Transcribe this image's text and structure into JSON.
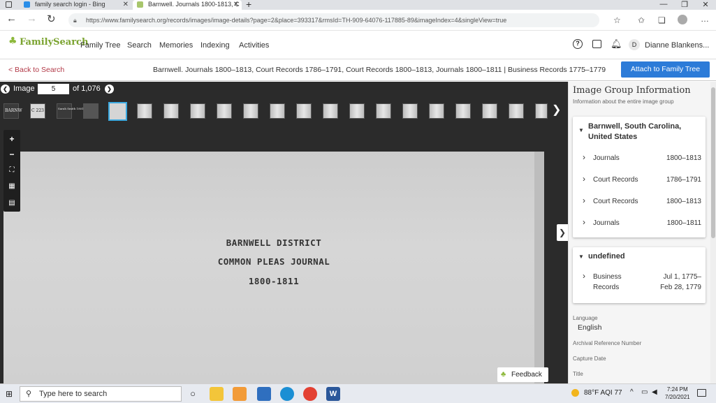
{
  "browser": {
    "tabs": [
      {
        "title": "family search login - Bing",
        "icon": "bing-icon",
        "active": false
      },
      {
        "title": "Barnwell. Journals 1800-1813, C",
        "icon": "familysearch-tree-icon",
        "active": true
      }
    ],
    "url": "https://www.familysearch.org/records/images/image-details?page=2&place=393317&rmsId=TH-909-64076-117885-89&imageIndex=4&singleView=true"
  },
  "header": {
    "logo": "FamilySearch",
    "nav": [
      "Family Tree",
      "Search",
      "Memories",
      "Indexing",
      "Activities"
    ],
    "avatar_initial": "D",
    "user_name": "Dianne Blankens..."
  },
  "subheader": {
    "back_label": "< Back to Search",
    "title": "Barnwell. Journals 1800–1813, Court Records 1786–1791, Court Records 1800–1813, Journals 1800–1811 | Business Records 1775–1779",
    "attach_label": "Attach to Family Tree"
  },
  "viewer": {
    "image_label": "Image",
    "image_number": "5",
    "image_total": "of 1,076",
    "thumb_labels": [
      "BARNW",
      "C 223",
      "Sarah Smith 1801",
      ""
    ],
    "document_lines": [
      "BARNWELL DISTRICT",
      "COMMON PLEAS JOURNAL",
      "1800-1811"
    ],
    "feedback_label": "Feedback"
  },
  "panel": {
    "title": "Image Group Information",
    "subtitle": "Information about the entire image group",
    "group1": {
      "heading": "Barnwell, South Carolina, United States",
      "rows": [
        {
          "name": "Journals",
          "dates": "1800–1813"
        },
        {
          "name": "Court Records",
          "dates": "1786–1791"
        },
        {
          "name": "Court Records",
          "dates": "1800–1813"
        },
        {
          "name": "Journals",
          "dates": "1800–1811"
        }
      ]
    },
    "group2": {
      "heading": "undefined",
      "rows": [
        {
          "name": "Business Records",
          "dates": "Jul 1, 1775– Feb 28, 1779"
        }
      ]
    },
    "meta": {
      "language_label": "Language",
      "language_value": "English",
      "archival_label": "Archival Reference Number",
      "capture_label": "Capture Date",
      "title_label": "Title"
    }
  },
  "taskbar": {
    "search_placeholder": "Type here to search",
    "weather": "88°F  AQI 77",
    "time": "7:24 PM",
    "date": "7/20/2021"
  },
  "colors": {
    "accent_blue": "#2c7bd8",
    "brand_green": "#7aa32f",
    "back_link": "#b23a48",
    "viewer_bg": "#2b2b2b"
  }
}
